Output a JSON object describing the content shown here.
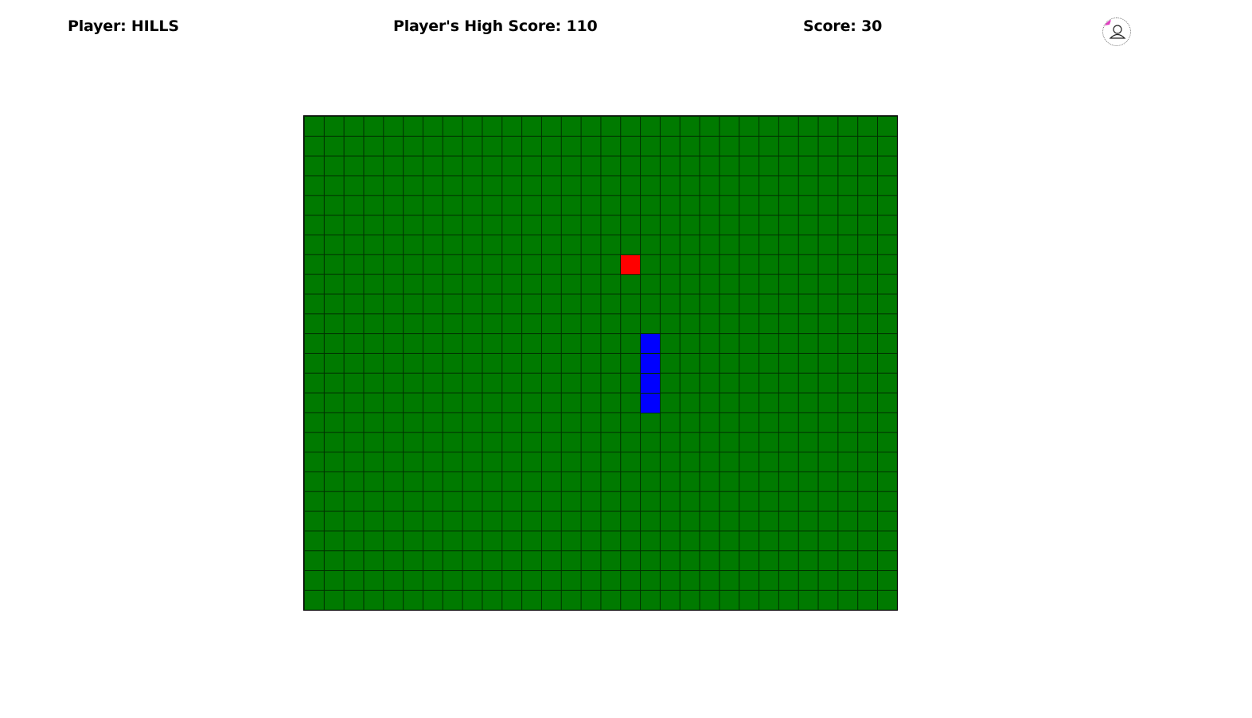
{
  "header": {
    "player_label": "Player: HILLS",
    "high_score_label": "Player's High Score: 110",
    "score_label": "Score: 30"
  },
  "avatar": {
    "icon": "user-profile-icon",
    "accent_color": "#e040c0"
  },
  "board": {
    "cols": 30,
    "rows": 25,
    "background_color": "#007a00",
    "grid_color": "#003000",
    "food": {
      "col": 16,
      "row": 7,
      "color": "#ff0000"
    },
    "snake": {
      "color": "#0000ff",
      "cells": [
        {
          "col": 17,
          "row": 11
        },
        {
          "col": 17,
          "row": 12
        },
        {
          "col": 17,
          "row": 13
        },
        {
          "col": 17,
          "row": 14
        }
      ]
    }
  }
}
